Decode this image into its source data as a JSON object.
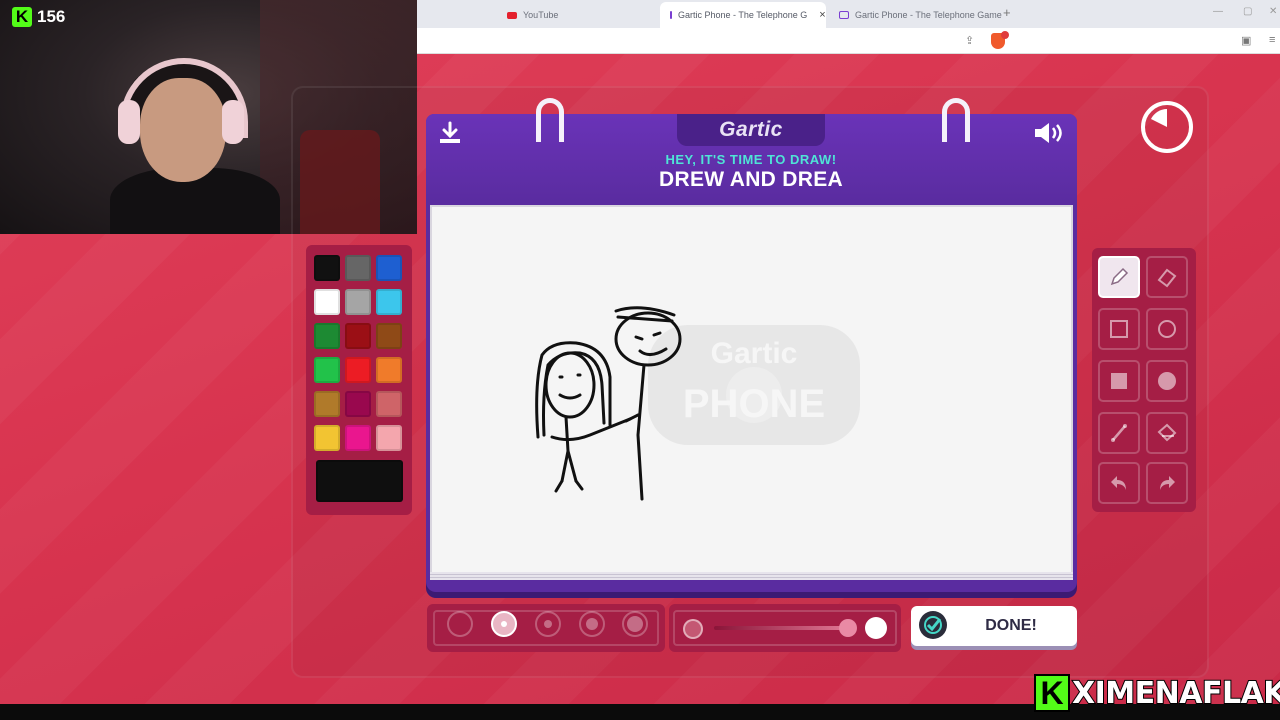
{
  "browser": {
    "tabs": [
      {
        "label": "YouTube",
        "icon": "youtube-icon"
      },
      {
        "label": "Gartic Phone - The Telephone G",
        "icon": "gartic-icon",
        "active": true
      },
      {
        "label": "Gartic Phone - The Telephone Game",
        "icon": "gartic-icon"
      }
    ],
    "new_tab": "+"
  },
  "stream": {
    "viewer_count": "156",
    "kick_letter": "K",
    "channel_name": "XIMENAFLAKA",
    "kick_color": "#53fc18"
  },
  "game": {
    "logo": "Gartic",
    "prompt_sub": "HEY, IT'S TIME TO DRAW!",
    "prompt_main": "DREW AND DREA",
    "watermark_top": "Gartic",
    "watermark_bottom": "PHONE",
    "done_label": "DONE!",
    "palette": [
      "#111111",
      "#666666",
      "#1e5fd1",
      "#ffffff",
      "#a5a5a5",
      "#3cc6ec",
      "#1d8a33",
      "#9b0f15",
      "#8f4a17",
      "#22c24a",
      "#ec1c24",
      "#f07b2a",
      "#b07a2a",
      "#99084e",
      "#cf6468",
      "#f2c432",
      "#ea168e",
      "#f4a6ad"
    ],
    "current_color": "#0f0f0f",
    "tools": [
      "pencil-icon",
      "eraser-icon",
      "square-outline-icon",
      "circle-outline-icon",
      "square-filled-icon",
      "circle-filled-icon",
      "line-icon",
      "fill-bucket-icon",
      "undo-icon",
      "redo-icon"
    ],
    "active_tool": "pencil-icon",
    "brush_sizes": 5,
    "active_size_index": 1,
    "opacity_level": 0.95,
    "accent": "#5a2ca0",
    "panel_color": "#a51e45"
  }
}
